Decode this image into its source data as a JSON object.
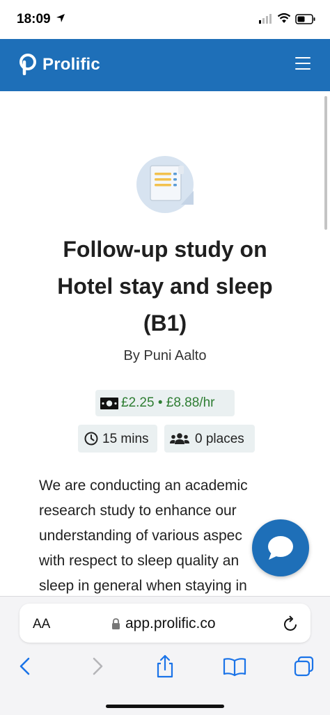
{
  "status_bar": {
    "time": "18:09"
  },
  "header": {
    "brand": "Prolific"
  },
  "study": {
    "title_lines": [
      "Follow-up study on",
      "Hotel stay and sleep",
      "(B1)"
    ],
    "author": "By Puni Aalto",
    "reward": "£2.25 • £8.88/hr",
    "duration": "15 mins",
    "places": "0 places",
    "description_lines": [
      "We are conducting an academic",
      "research study to enhance our",
      "understanding of various aspec",
      "with respect to sleep quality an",
      "sleep in general when staying in"
    ]
  },
  "browser": {
    "text_size_label": "AA",
    "url": "app.prolific.co"
  },
  "colors": {
    "brand_blue": "#1e6fb8",
    "reward_green": "#2e7d32",
    "chip_bg": "#eaf0f1"
  }
}
